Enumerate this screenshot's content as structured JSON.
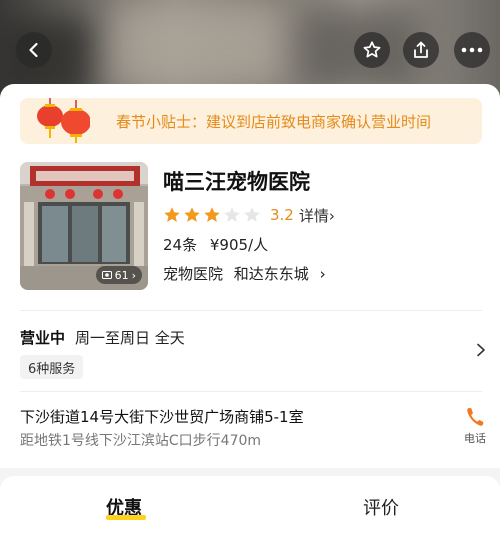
{
  "header": {
    "icons": [
      "back-arrow-icon",
      "star-outline-icon",
      "share-icon",
      "more-dots-icon"
    ]
  },
  "tip": {
    "text": "春节小贴士：建议到店前致电商家确认营业时间",
    "color": "#e58b1a"
  },
  "shop": {
    "name": "喵三汪宠物医院",
    "photo_count": "61",
    "rating": 3.2,
    "rating_text": "3.2",
    "stars_filled": 3,
    "stars_total": 5,
    "detail_label": "详情",
    "review_count": "24条",
    "avg_price": "¥905/人",
    "category": "宠物医院",
    "area": "和达东东城"
  },
  "hours": {
    "status": "营业中",
    "text": "周一至周日 全天",
    "services": "6种服务"
  },
  "address": {
    "line": "下沙街道14号大街下沙世贸广场商铺5-1室",
    "distance": "距地铁1号线下沙江滨站C口步行470m",
    "call_label": "电话"
  },
  "tabs": [
    {
      "label": "优惠",
      "active": true
    },
    {
      "label": "评价",
      "active": false
    }
  ],
  "colors": {
    "accent": "#e58b1a",
    "star": "#f39a1e",
    "tab_underline": "#ffd21e"
  }
}
